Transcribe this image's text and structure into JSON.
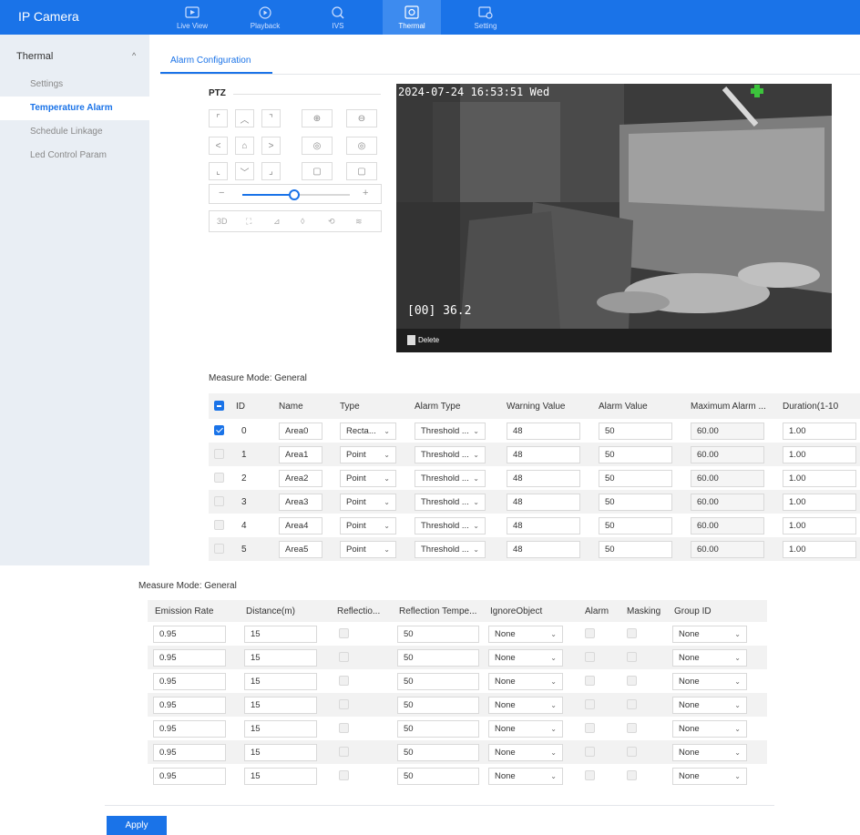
{
  "app": {
    "title": "IP Camera"
  },
  "nav": [
    {
      "label": "Live View",
      "icon": "live-view-icon"
    },
    {
      "label": "Playback",
      "icon": "playback-icon"
    },
    {
      "label": "IVS",
      "icon": "ivs-icon"
    },
    {
      "label": "Thermal",
      "icon": "thermal-icon",
      "active": true
    },
    {
      "label": "Setting",
      "icon": "setting-icon"
    }
  ],
  "sidebar": {
    "section": "Thermal",
    "items": [
      "Settings",
      "Temperature Alarm",
      "Schedule Linkage",
      "Led Control Param"
    ],
    "active": "Temperature Alarm"
  },
  "tab": {
    "label": "Alarm Configuration"
  },
  "ptz": {
    "title": "PTZ",
    "toolbar_3d": "3D"
  },
  "video": {
    "timestamp": "2024-07-24 16:53:51 Wed",
    "reading": "[00] 36.2",
    "delete_label": "Delete"
  },
  "table1": {
    "measure_mode": "Measure Mode:  General",
    "headers": [
      "ID",
      "Name",
      "Type",
      "Alarm Type",
      "Warning Value",
      "Alarm Value",
      "Maximum Alarm ...",
      "Duration(1-10"
    ],
    "rows": [
      {
        "checked": true,
        "id": "0",
        "name": "Area0",
        "type": "Recta...",
        "alarm_type": "Threshold ...",
        "warning": "48",
        "alarm": "50",
        "max_alarm": "60.00",
        "duration": "1.00"
      },
      {
        "checked": false,
        "id": "1",
        "name": "Area1",
        "type": "Point",
        "alarm_type": "Threshold ...",
        "warning": "48",
        "alarm": "50",
        "max_alarm": "60.00",
        "duration": "1.00"
      },
      {
        "checked": false,
        "id": "2",
        "name": "Area2",
        "type": "Point",
        "alarm_type": "Threshold ...",
        "warning": "48",
        "alarm": "50",
        "max_alarm": "60.00",
        "duration": "1.00"
      },
      {
        "checked": false,
        "id": "3",
        "name": "Area3",
        "type": "Point",
        "alarm_type": "Threshold ...",
        "warning": "48",
        "alarm": "50",
        "max_alarm": "60.00",
        "duration": "1.00"
      },
      {
        "checked": false,
        "id": "4",
        "name": "Area4",
        "type": "Point",
        "alarm_type": "Threshold ...",
        "warning": "48",
        "alarm": "50",
        "max_alarm": "60.00",
        "duration": "1.00"
      },
      {
        "checked": false,
        "id": "5",
        "name": "Area5",
        "type": "Point",
        "alarm_type": "Threshold ...",
        "warning": "48",
        "alarm": "50",
        "max_alarm": "60.00",
        "duration": "1.00"
      }
    ]
  },
  "table2": {
    "measure_mode": "Measure Mode:  General",
    "headers": [
      "Emission Rate",
      "Distance(m)",
      "Reflectio...",
      "Reflection Tempe...",
      "IgnoreObject",
      "Alarm",
      "Masking",
      "Group ID"
    ],
    "rows": [
      {
        "emission": "0.95",
        "distance": "15",
        "refl_temp": "50",
        "ignore": "None",
        "group": "None"
      },
      {
        "emission": "0.95",
        "distance": "15",
        "refl_temp": "50",
        "ignore": "None",
        "group": "None"
      },
      {
        "emission": "0.95",
        "distance": "15",
        "refl_temp": "50",
        "ignore": "None",
        "group": "None"
      },
      {
        "emission": "0.95",
        "distance": "15",
        "refl_temp": "50",
        "ignore": "None",
        "group": "None"
      },
      {
        "emission": "0.95",
        "distance": "15",
        "refl_temp": "50",
        "ignore": "None",
        "group": "None"
      },
      {
        "emission": "0.95",
        "distance": "15",
        "refl_temp": "50",
        "ignore": "None",
        "group": "None"
      },
      {
        "emission": "0.95",
        "distance": "15",
        "refl_temp": "50",
        "ignore": "None",
        "group": "None"
      }
    ]
  },
  "apply_label": "Apply",
  "colors": {
    "accent": "#1a73e8",
    "sidebar": "#e9eef4"
  }
}
